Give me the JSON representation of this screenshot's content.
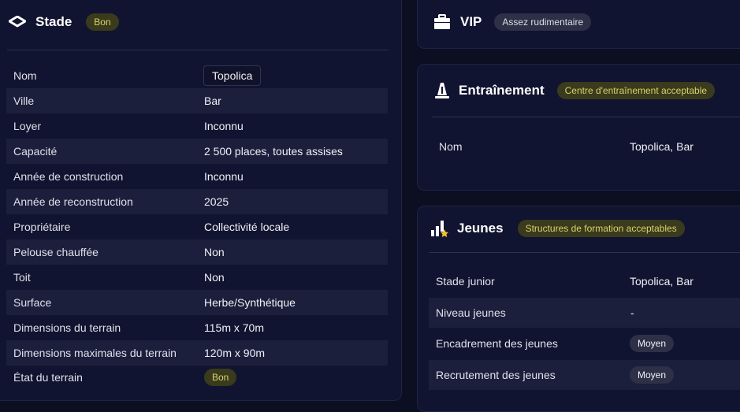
{
  "stade": {
    "title": "Stade",
    "badge": "Bon",
    "rows": [
      {
        "label": "Nom",
        "value": "Topolica"
      },
      {
        "label": "Ville",
        "value": "Bar"
      },
      {
        "label": "Loyer",
        "value": "Inconnu"
      },
      {
        "label": "Capacité",
        "value": "2 500 places, toutes assises"
      },
      {
        "label": "Année de construction",
        "value": "Inconnu"
      },
      {
        "label": "Année de reconstruction",
        "value": "2025"
      },
      {
        "label": "Propriétaire",
        "value": "Collectivité locale"
      },
      {
        "label": "Pelouse chauffée",
        "value": "Non"
      },
      {
        "label": "Toit",
        "value": "Non"
      },
      {
        "label": "Surface",
        "value": "Herbe/Synthétique"
      },
      {
        "label": "Dimensions du terrain",
        "value": "115m x 70m"
      },
      {
        "label": "Dimensions maximales du terrain",
        "value": "120m x 90m"
      },
      {
        "label": "État du terrain",
        "value": "Bon"
      }
    ]
  },
  "vip": {
    "title": "VIP",
    "badge": "Assez rudimentaire"
  },
  "entrainement": {
    "title": "Entraînement",
    "badge": "Centre d'entraînement acceptable",
    "rows": [
      {
        "label": "Nom",
        "value": "Topolica, Bar"
      }
    ]
  },
  "jeunes": {
    "title": "Jeunes",
    "badge": "Structures de formation acceptables",
    "rows": [
      {
        "label": "Stade junior",
        "value": "Topolica, Bar"
      },
      {
        "label": "Niveau jeunes",
        "value": "-"
      },
      {
        "label": "Encadrement des jeunes",
        "value": "Moyen"
      },
      {
        "label": "Recrutement des jeunes",
        "value": "Moyen"
      }
    ]
  },
  "colors": {
    "background": "#0c0e22",
    "card": "#111430",
    "stripe": "#1b1f3c",
    "badge_olive_bg": "#3a3a1d",
    "badge_olive_text": "#d9d36a",
    "badge_grey_bg": "#2e3047"
  },
  "icons": {
    "stade": "stadium-icon",
    "vip": "vip-briefcase-icon",
    "entrainement": "training-cone-icon",
    "jeunes": "youth-chart-star-icon"
  }
}
